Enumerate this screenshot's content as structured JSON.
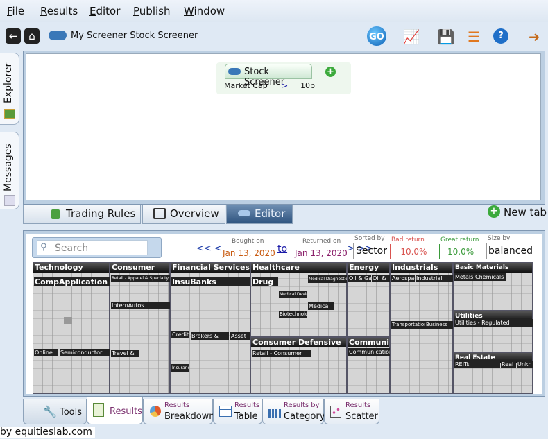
{
  "menu": {
    "items": [
      "File",
      "Results",
      "Editor",
      "Publish",
      "Window"
    ]
  },
  "toolbar": {
    "title": "My Screener Stock Screener",
    "go_label": "GO"
  },
  "side_tabs": {
    "explorer": "Explorer",
    "messages": "Messages"
  },
  "rule": {
    "header": "Stock Screener",
    "field": "Market Cap",
    "operator": ">",
    "value": "10b"
  },
  "tabs": {
    "trading_rules": "Trading Rules",
    "overview": "Overview",
    "editor": "Editor",
    "new_tab": "New tab"
  },
  "filter": {
    "search_placeholder": "Search",
    "prev": "<< <",
    "bought_on_label": "Bought on",
    "bought_on": "Jan 13, 2020",
    "to": "to",
    "returned_on_label": "Returned on",
    "returned_on": "Jan 13, 2020",
    "next": "> >>",
    "sorted_by_label": "Sorted by",
    "sorted_by": "Sector",
    "bad_return_label": "Bad return",
    "bad_return": "-10.0%",
    "great_return_label": "Great return",
    "great_return": "10.0%",
    "size_by_label": "Size by",
    "size_by": "balanced"
  },
  "treemap": {
    "sectors": [
      "Technology",
      "Consumer",
      "Financial Services",
      "Healthcare",
      "Energy",
      "Industrials",
      "Basic Materials",
      "Consumer Defensive",
      "Communicat",
      "Utilities",
      "Real Estate"
    ],
    "industries": [
      "CompApplication",
      "Retail - Apparel & Specialty",
      "InternAutos",
      "Travel &",
      "InsuBanks",
      "Credit",
      "Brokers &",
      "Asset",
      "Insurance -",
      "Drug",
      "Medical Diagnostic",
      "Medical",
      "Oil & Gas",
      "Oil &",
      "Aerospace",
      "Industrial",
      "Transportation",
      "Business",
      "Metals",
      "Chemicals",
      "Utilities - Regulated",
      "REITs",
      "Real",
      "Unkn",
      "Retail - Consumer",
      "Online",
      "Semiconductor",
      "Communication",
      "Biotechnology",
      "Medical Devices"
    ]
  },
  "bottom_tabs": {
    "tools": "Tools",
    "results": "Results",
    "breakdown_small": "Results",
    "breakdown": "Breakdown",
    "table_small": "Results",
    "table": "Table",
    "category_small": "Results by",
    "category": "Category",
    "scatter_small": "Results",
    "scatter": "Scatter"
  },
  "footer": "by equitieslab.com",
  "colors": {
    "bad": "#d9534f",
    "great": "#3a9a3a",
    "accent": "#1a4f9c"
  }
}
